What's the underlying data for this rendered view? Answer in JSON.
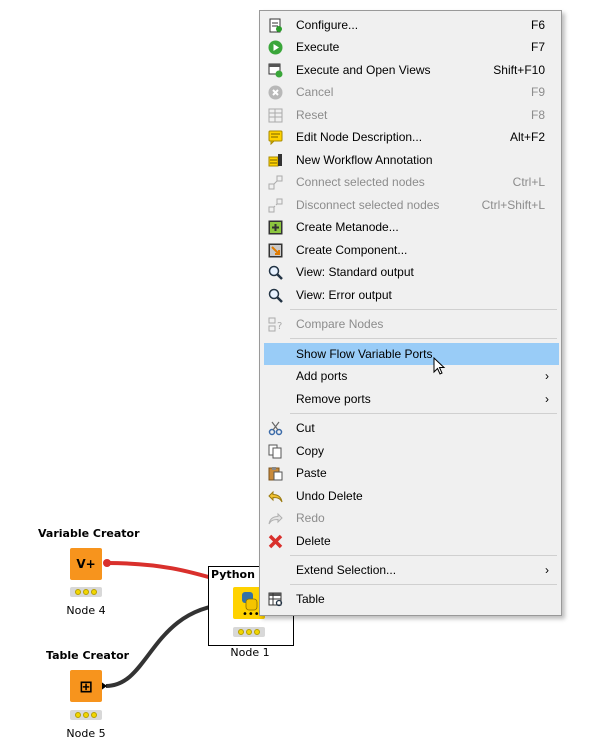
{
  "canvas": {
    "nodes": [
      {
        "title": "Variable Creator",
        "label": "Node 4"
      },
      {
        "title": "Table Creator",
        "label": "Node 5"
      },
      {
        "title": "Python Sc",
        "label": "Node 1"
      }
    ],
    "variable_icon": "V+",
    "table_icon": "⊞"
  },
  "menu": {
    "items": [
      {
        "label": "Configure...",
        "shortcut": "F6",
        "icon": "configure-icon",
        "disabled": false
      },
      {
        "label": "Execute",
        "shortcut": "F7",
        "icon": "execute-icon",
        "disabled": false
      },
      {
        "label": "Execute and Open Views",
        "shortcut": "Shift+F10",
        "icon": "execute-open-views-icon",
        "disabled": false
      },
      {
        "label": "Cancel",
        "shortcut": "F9",
        "icon": "cancel-icon",
        "disabled": true
      },
      {
        "label": "Reset",
        "shortcut": "F8",
        "icon": "reset-icon",
        "disabled": true
      },
      {
        "label": "Edit Node Description...",
        "shortcut": "Alt+F2",
        "icon": "edit-description-icon",
        "disabled": false
      },
      {
        "label": "New Workflow Annotation",
        "shortcut": "",
        "icon": "annotation-icon",
        "disabled": false
      },
      {
        "label": "Connect selected nodes",
        "shortcut": "Ctrl+L",
        "icon": "connect-nodes-icon",
        "disabled": true
      },
      {
        "label": "Disconnect selected nodes",
        "shortcut": "Ctrl+Shift+L",
        "icon": "disconnect-nodes-icon",
        "disabled": true
      },
      {
        "label": "Create Metanode...",
        "shortcut": "",
        "icon": "metanode-icon",
        "disabled": false
      },
      {
        "label": "Create Component...",
        "shortcut": "",
        "icon": "component-icon",
        "disabled": false
      },
      {
        "label": "View: Standard output",
        "shortcut": "",
        "icon": "magnifier-icon",
        "disabled": false
      },
      {
        "label": "View: Error output",
        "shortcut": "",
        "icon": "magnifier-icon",
        "disabled": false
      },
      {
        "label": "Compare Nodes",
        "shortcut": "",
        "icon": "compare-nodes-icon",
        "disabled": true
      },
      {
        "label": "Show Flow Variable Ports",
        "shortcut": "",
        "icon": "",
        "disabled": false,
        "hover": true
      },
      {
        "label": "Add ports",
        "shortcut": "",
        "icon": "",
        "disabled": false,
        "submenu": true
      },
      {
        "label": "Remove ports",
        "shortcut": "",
        "icon": "",
        "disabled": false,
        "submenu": true
      },
      {
        "label": "Cut",
        "shortcut": "",
        "icon": "scissors-icon",
        "disabled": false
      },
      {
        "label": "Copy",
        "shortcut": "",
        "icon": "copy-icon",
        "disabled": false
      },
      {
        "label": "Paste",
        "shortcut": "",
        "icon": "paste-icon",
        "disabled": false
      },
      {
        "label": "Undo Delete",
        "shortcut": "",
        "icon": "undo-icon",
        "disabled": false
      },
      {
        "label": "Redo",
        "shortcut": "",
        "icon": "redo-icon",
        "disabled": true
      },
      {
        "label": "Delete",
        "shortcut": "",
        "icon": "delete-x-icon",
        "disabled": false
      },
      {
        "label": "Extend Selection...",
        "shortcut": "",
        "icon": "",
        "disabled": false,
        "submenu": true
      },
      {
        "label": "Table",
        "shortcut": "",
        "icon": "table-view-icon",
        "disabled": false
      }
    ]
  },
  "colors": {
    "node_orange": "#f7941d",
    "python_yellow": "#ffd200",
    "flow_variable_red": "#d9302c",
    "menu_hover": "#99ccf7"
  }
}
